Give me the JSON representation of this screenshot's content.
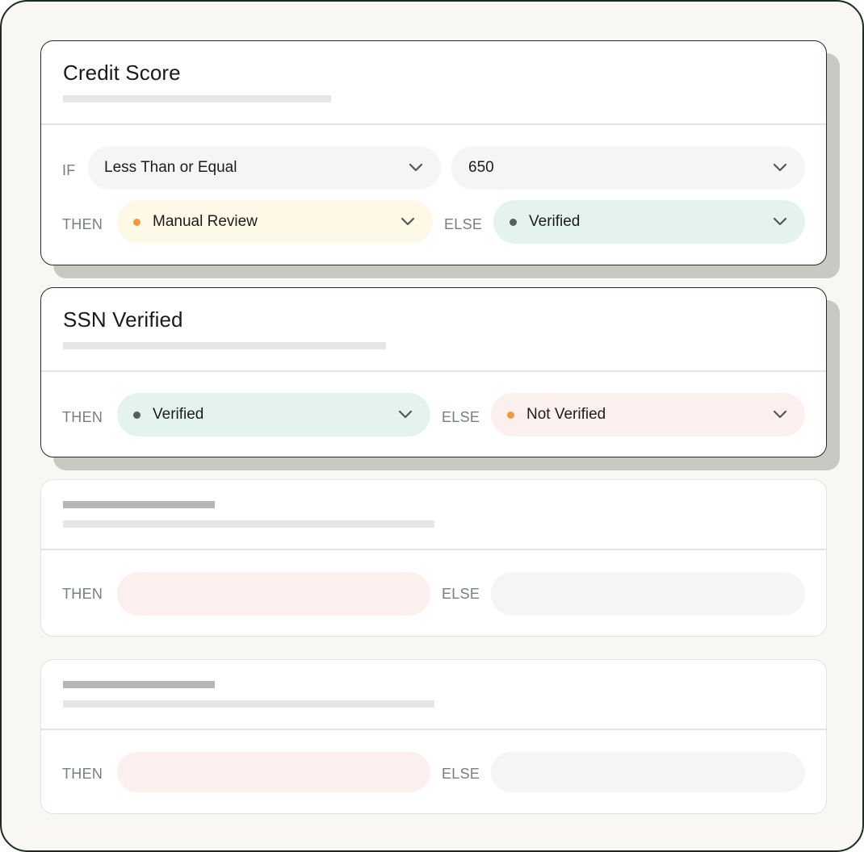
{
  "rules": {
    "credit_score": {
      "title": "Credit Score",
      "if_keyword": "IF",
      "then_keyword": "THEN",
      "else_keyword": "ELSE",
      "operator": {
        "value": "Less Than or Equal"
      },
      "threshold": {
        "value": "650"
      },
      "then_outcome": {
        "value": "Manual Review",
        "dot_color": "#f09a3e"
      },
      "else_outcome": {
        "value": "Verified",
        "dot_color": "#55605b"
      }
    },
    "ssn_verified": {
      "title": "SSN Verified",
      "then_keyword": "THEN",
      "else_keyword": "ELSE",
      "then_outcome": {
        "value": "Verified",
        "dot_color": "#55605b"
      },
      "else_outcome": {
        "value": "Not Verified",
        "dot_color": "#f09a3e"
      }
    },
    "placeholder_1": {
      "then_keyword": "THEN",
      "else_keyword": "ELSE"
    },
    "placeholder_2": {
      "then_keyword": "THEN",
      "else_keyword": "ELSE"
    }
  },
  "colors": {
    "border_dark": "#1f2d27",
    "pill_gray": "#f5f5f5",
    "pill_yellow": "#fef8e6",
    "pill_green": "#e5f3f0",
    "pill_pink": "#fbf0ee",
    "dot_orange": "#f09a3e",
    "dot_dark": "#55605b"
  }
}
